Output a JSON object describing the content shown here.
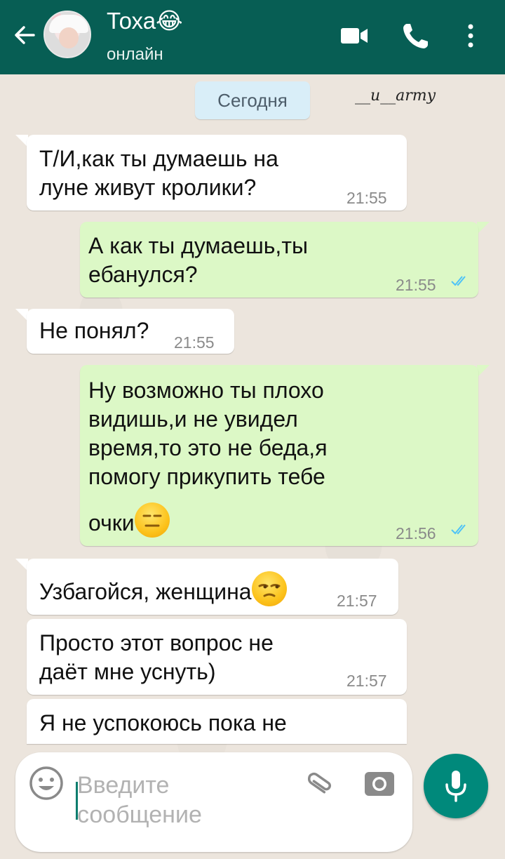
{
  "header": {
    "contact_name": "Тоха😂",
    "status": "онлайн",
    "icons": [
      "back-arrow-icon",
      "video-call-icon",
      "phone-call-icon",
      "more-menu-icon"
    ]
  },
  "date_label": "Сегодня",
  "watermark": "__u__army",
  "messages": [
    {
      "direction": "in",
      "text_lines": [
        "Т/И,как ты думаешь на",
        "луне живут кролики?"
      ],
      "time": "21:55"
    },
    {
      "direction": "out",
      "text_lines": [
        "А как ты думаешь,ты",
        "ебанулся?"
      ],
      "time": "21:55",
      "read": true
    },
    {
      "direction": "in",
      "text_lines": [
        "Не понял?"
      ],
      "time": "21:55"
    },
    {
      "direction": "out",
      "text_lines": [
        "Ну возможно ты плохо",
        "видишь,и не увидел",
        "время,то это не беда,я",
        "помогу прикупить тебе",
        "очки"
      ],
      "emoji": "expressionless-face",
      "time": "21:56",
      "read": true
    },
    {
      "direction": "in",
      "text_lines": [
        "Узбагойся, женщина"
      ],
      "emoji": "unamused-face",
      "time": "21:57"
    },
    {
      "direction": "in",
      "text_lines": [
        "Просто этот вопрос не",
        "даёт мне уснуть)"
      ],
      "time": "21:57"
    },
    {
      "direction": "in",
      "text_lines": [
        "Я не успокоюсь пока не"
      ],
      "time": ""
    }
  ],
  "input": {
    "placeholder_line1": "Введите",
    "placeholder_line2": "сообщение"
  },
  "colors": {
    "header": "#075e54",
    "outgoing_bubble": "#dcf8c6",
    "incoming_bubble": "#ffffff",
    "accent": "#00897b",
    "read_ticks": "#4fc3f7"
  }
}
